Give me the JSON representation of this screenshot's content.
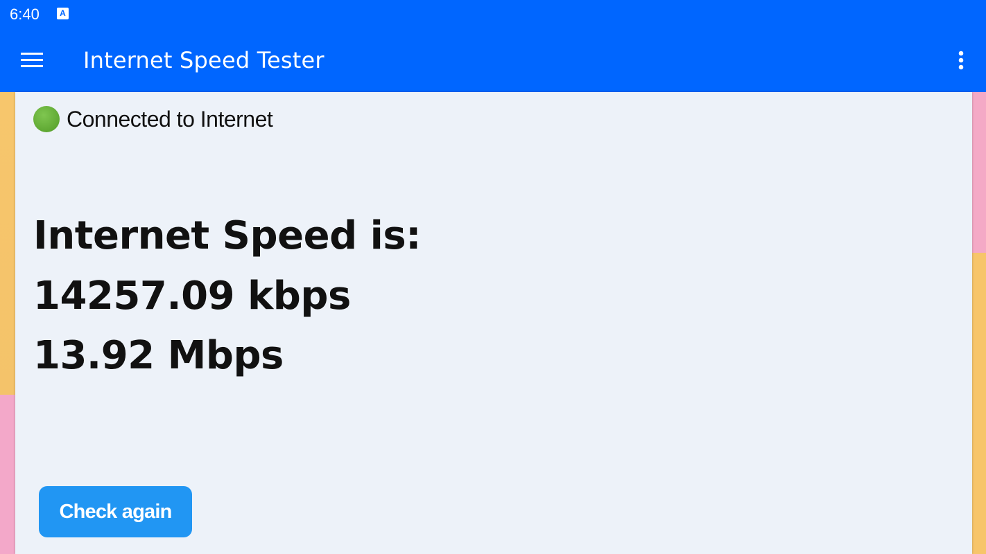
{
  "status_bar": {
    "time": "6:40",
    "notification_icon": "A"
  },
  "app_bar": {
    "title": "Internet Speed Tester",
    "menu_icon": "hamburger-menu-icon",
    "overflow_icon": "more-vert-icon",
    "background_color": "#0066ff"
  },
  "connection": {
    "status_text": "Connected to Internet",
    "indicator_color": "#5fa833"
  },
  "speed": {
    "heading": "Internet Speed is:",
    "kbps": "14257.09 kbps",
    "mbps": "13.92 Mbps"
  },
  "actions": {
    "check_again_label": "Check again",
    "button_color": "#2196f3"
  }
}
